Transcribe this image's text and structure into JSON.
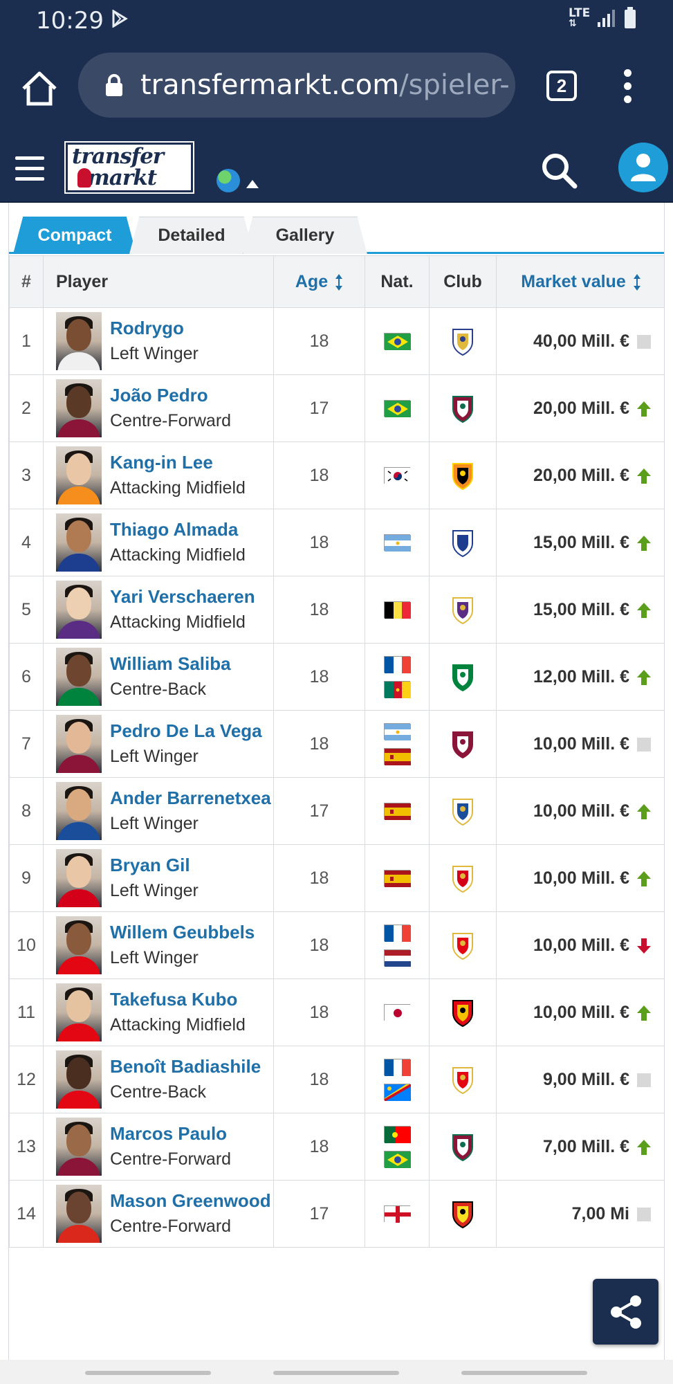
{
  "status_bar": {
    "time": "10:29",
    "network": "LTE"
  },
  "browser": {
    "url_host": "transfermarkt.com",
    "url_path": "/spieler-s",
    "tab_count": "2"
  },
  "site": {
    "logo_line1": "transfer",
    "logo_line2": "markt"
  },
  "tabs": [
    {
      "label": "Compact",
      "active": true
    },
    {
      "label": "Detailed",
      "active": false
    },
    {
      "label": "Gallery",
      "active": false
    }
  ],
  "table": {
    "headers": {
      "num": "#",
      "player": "Player",
      "age": "Age",
      "nat": "Nat.",
      "club": "Club",
      "market_value": "Market value"
    },
    "rows": [
      {
        "num": "1",
        "name": "Rodrygo",
        "position": "Left Winger",
        "age": "18",
        "flags": [
          "brazil"
        ],
        "club": "real-madrid-crest",
        "value": "40,00 Mill. €",
        "trend": "none"
      },
      {
        "num": "2",
        "name": "João Pedro",
        "position": "Centre-Forward",
        "age": "17",
        "flags": [
          "brazil"
        ],
        "club": "fluminense-crest",
        "value": "20,00 Mill. €",
        "trend": "up"
      },
      {
        "num": "3",
        "name": "Kang-in Lee",
        "position": "Attacking Midfield",
        "age": "18",
        "flags": [
          "south-korea"
        ],
        "club": "valencia-crest",
        "value": "20,00 Mill. €",
        "trend": "up"
      },
      {
        "num": "4",
        "name": "Thiago Almada",
        "position": "Attacking Midfield",
        "age": "18",
        "flags": [
          "argentina"
        ],
        "club": "velez-crest",
        "value": "15,00 Mill. €",
        "trend": "up"
      },
      {
        "num": "5",
        "name": "Yari Verschaeren",
        "position": "Attacking Midfield",
        "age": "18",
        "flags": [
          "belgium"
        ],
        "club": "anderlecht-crest",
        "value": "15,00 Mill. €",
        "trend": "up"
      },
      {
        "num": "6",
        "name": "William Saliba",
        "position": "Centre-Back",
        "age": "18",
        "flags": [
          "france",
          "cameroon"
        ],
        "club": "saint-etienne-crest",
        "value": "12,00 Mill. €",
        "trend": "up"
      },
      {
        "num": "7",
        "name": "Pedro De La Vega",
        "position": "Left Winger",
        "age": "18",
        "flags": [
          "argentina",
          "spain"
        ],
        "club": "lanus-crest",
        "value": "10,00 Mill. €",
        "trend": "none"
      },
      {
        "num": "8",
        "name": "Ander Barrenetxea",
        "position": "Left Winger",
        "age": "17",
        "flags": [
          "spain"
        ],
        "club": "real-sociedad-crest",
        "value": "10,00 Mill. €",
        "trend": "up"
      },
      {
        "num": "9",
        "name": "Bryan Gil",
        "position": "Left Winger",
        "age": "18",
        "flags": [
          "spain"
        ],
        "club": "sevilla-crest",
        "value": "10,00 Mill. €",
        "trend": "up"
      },
      {
        "num": "10",
        "name": "Willem Geubbels",
        "position": "Left Winger",
        "age": "18",
        "flags": [
          "france",
          "netherlands"
        ],
        "club": "monaco-crest",
        "value": "10,00 Mill. €",
        "trend": "down"
      },
      {
        "num": "11",
        "name": "Takefusa Kubo",
        "position": "Attacking Midfield",
        "age": "18",
        "flags": [
          "japan"
        ],
        "club": "mallorca-crest",
        "value": "10,00 Mill. €",
        "trend": "up"
      },
      {
        "num": "12",
        "name": "Benoît Badiashile",
        "position": "Centre-Back",
        "age": "18",
        "flags": [
          "france",
          "dr-congo"
        ],
        "club": "monaco-crest",
        "value": "9,00 Mill. €",
        "trend": "none"
      },
      {
        "num": "13",
        "name": "Marcos Paulo",
        "position": "Centre-Forward",
        "age": "18",
        "flags": [
          "portugal",
          "brazil"
        ],
        "club": "fluminense-crest",
        "value": "7,00 Mill. €",
        "trend": "up"
      },
      {
        "num": "14",
        "name": "Mason Greenwood",
        "position": "Centre-Forward",
        "age": "17",
        "flags": [
          "england"
        ],
        "club": "manchester-united-crest",
        "value": "7,00 Mi",
        "trend": "none"
      }
    ]
  },
  "colors": {
    "navy": "#1b2e4f",
    "accent": "#1e9dd8",
    "link": "#1f6fa8",
    "trend_up": "#5a9e1c",
    "trend_down": "#c8102e"
  }
}
